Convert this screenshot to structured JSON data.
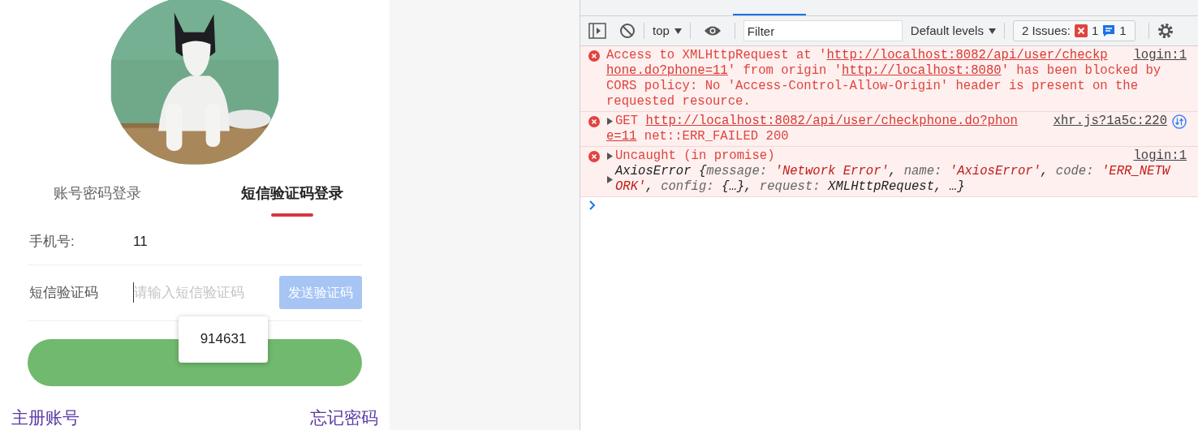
{
  "login": {
    "tabs": [
      {
        "label": "账号密码登录",
        "selected": false
      },
      {
        "label": "短信验证码登录",
        "selected": true
      }
    ],
    "phone": {
      "label": "手机号:",
      "value": "11"
    },
    "code": {
      "label": "短信验证码",
      "placeholder": "请输入短信验证码",
      "send_button": "发送验证码",
      "send_disabled": true
    },
    "autofill_popup": "914631",
    "links": [
      "主册账号",
      "忘记密码"
    ]
  },
  "devtools": {
    "toolbar": {
      "context": "top",
      "filter_placeholder": "Filter",
      "levels": "Default levels",
      "issues_label": "2 Issues:",
      "error_count": "1",
      "info_count": "1"
    },
    "messages": [
      {
        "expandable": false,
        "network": false,
        "source": "login:1",
        "lines": [
          [
            {
              "kind": "text",
              "text": "Access to XMLHttpRequest at '"
            },
            {
              "kind": "link",
              "text": "http://localhost:8082/api/user/checkp"
            }
          ],
          [
            {
              "kind": "link",
              "text": "hone.do?phone=11"
            },
            {
              "kind": "text",
              "text": "' from origin '"
            },
            {
              "kind": "link",
              "text": "http://localhost:8080"
            },
            {
              "kind": "text",
              "text": "' has been blocked by"
            }
          ],
          [
            {
              "kind": "text",
              "text": "CORS policy: No 'Access-Control-Allow-Origin' header is present on the"
            }
          ],
          [
            {
              "kind": "text",
              "text": "requested resource."
            }
          ]
        ]
      },
      {
        "expandable": true,
        "network": true,
        "source": "xhr.js?1a5c:220",
        "lines": [
          [
            {
              "kind": "text",
              "text": "GET "
            },
            {
              "kind": "link",
              "text": "http://localhost:8082/api/user/checkphone.do?phon"
            }
          ],
          [
            {
              "kind": "link",
              "text": "e=11"
            },
            {
              "kind": "text",
              "text": " net::ERR_FAILED 200"
            }
          ]
        ]
      },
      {
        "expandable": true,
        "network": false,
        "source": "login:1",
        "lines": [
          [
            {
              "kind": "text",
              "text": "Uncaught (in promise)"
            }
          ]
        ],
        "object": {
          "expanded": false,
          "lines": [
            [
              {
                "kind": "name",
                "text": "AxiosError {"
              },
              {
                "kind": "key",
                "text": "message: "
              },
              {
                "kind": "string",
                "text": "'Network Error'"
              },
              {
                "kind": "name",
                "text": ", "
              },
              {
                "kind": "key",
                "text": "name: "
              },
              {
                "kind": "string",
                "text": "'AxiosError'"
              },
              {
                "kind": "name",
                "text": ", "
              },
              {
                "kind": "key",
                "text": "code: "
              },
              {
                "kind": "string",
                "text": "'ERR_NETW"
              }
            ],
            [
              {
                "kind": "string",
                "text": "ORK'"
              },
              {
                "kind": "name",
                "text": ", "
              },
              {
                "kind": "key",
                "text": "config: "
              },
              {
                "kind": "name",
                "text": "{…}, "
              },
              {
                "kind": "key",
                "text": "request: "
              },
              {
                "kind": "name",
                "text": "XMLHttpRequest, …}"
              }
            ]
          ]
        }
      }
    ]
  }
}
